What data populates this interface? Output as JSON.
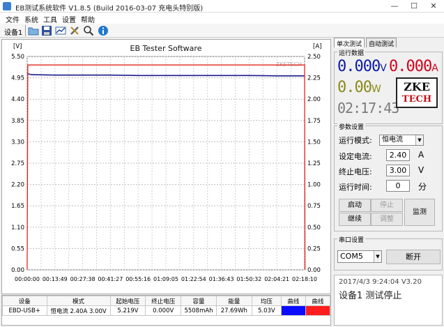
{
  "window": {
    "title": "EB测试系统软件 V1.8.5 (Build 2016-03-07 充电头特别版)",
    "minimize": "—",
    "maximize": "☐",
    "close": "✕"
  },
  "menu": [
    "文件",
    "系统",
    "工具",
    "设置",
    "帮助"
  ],
  "toolbar": {
    "device_label": "设备1",
    "icons": [
      "folder-open-icon",
      "save-icon",
      "chart-icon",
      "tools-icon",
      "search-icon",
      "info-icon"
    ]
  },
  "chart_data": {
    "type": "line",
    "title": "EB Tester Software",
    "watermark": "ZKETECH",
    "y_left_unit": "[V]",
    "y_right_unit": "[A]",
    "y_left_ticks": [
      "5.50",
      "4.95",
      "4.40",
      "3.85",
      "3.30",
      "2.75",
      "2.20",
      "1.65",
      "1.10",
      "0.55",
      "0.00"
    ],
    "y_right_ticks": [
      "2.50",
      "2.25",
      "2.00",
      "1.75",
      "1.50",
      "1.25",
      "1.00",
      "0.75",
      "0.50",
      "0.25",
      "0.00"
    ],
    "x_ticks": [
      "00:00:00",
      "00:13:49",
      "00:27:38",
      "00:41:27",
      "00:55:16",
      "01:09:05",
      "01:22:54",
      "01:36:43",
      "01:50:32",
      "02:04:21",
      "02:18:10"
    ],
    "ylim_left": [
      0,
      5.5
    ],
    "ylim_right": [
      0,
      2.5
    ],
    "series": [
      {
        "axis": "left",
        "color": "#1a1a8c",
        "x_minutes": [
          0,
          2,
          13.8,
          27.6,
          41.4,
          55.3,
          69.1,
          82.9,
          96.7,
          110.5,
          124.4,
          138.2
        ],
        "values": [
          5.06,
          5.03,
          5.02,
          5.02,
          5.02,
          5.01,
          5.01,
          5.01,
          5.01,
          5.01,
          5.0,
          5.0
        ]
      },
      {
        "axis": "right",
        "color": "#e0261e",
        "x_minutes": [
          0,
          0.3,
          138.2,
          138.4
        ],
        "values": [
          0,
          2.4,
          2.4,
          0
        ]
      }
    ]
  },
  "table": {
    "headers": [
      "设备",
      "模式",
      "起始电压",
      "终止电压",
      "容量",
      "能量",
      "均压",
      "曲线",
      "曲线"
    ],
    "row": [
      "EBD-USB+",
      "恒电流  2.40A  3.00V",
      "5.219V",
      "0.000V",
      "5508mAh",
      "27.69Wh",
      "5.03V",
      "",
      ""
    ]
  },
  "right": {
    "tabs": [
      "单次测试",
      "自动测试"
    ],
    "run_data_title": "运行数据",
    "voltage": "0.000",
    "voltage_unit": "V",
    "current": "0.000",
    "current_unit": "A",
    "power": "0.00",
    "power_unit": "W",
    "time": "02:17:43",
    "logo_line1": "ZKE",
    "logo_line2": "TECH",
    "params_title": "参数设置",
    "mode_label": "运行模式:",
    "mode_value": "恒电流",
    "set_current_label": "设定电流:",
    "set_current_value": "2.40",
    "set_current_unit": "A",
    "stop_voltage_label": "终止电压:",
    "stop_voltage_value": "3.00",
    "stop_voltage_unit": "V",
    "run_time_label": "运行时间:",
    "run_time_value": "0",
    "run_time_unit": "分",
    "btn_start": "启动",
    "btn_stop": "停止",
    "btn_continue": "继续",
    "btn_adjust": "调整",
    "btn_monitor": "监测",
    "serial_title": "串口设置",
    "com_port": "COM5",
    "btn_disconnect": "断开",
    "status_line1": "2017/4/3 9:24:04  V3.20",
    "status_line2": "设备1 测试停止"
  }
}
